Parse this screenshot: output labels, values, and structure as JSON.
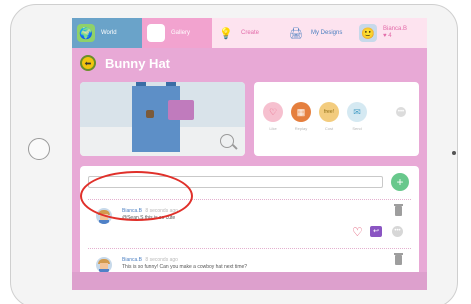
{
  "nav": {
    "tabs": [
      {
        "label": "World",
        "icon": "globe-icon"
      },
      {
        "label": "Gallery",
        "icon": "gallery-icon"
      },
      {
        "label": "Create",
        "icon": "lightbulb-icon"
      },
      {
        "label": "My Designs",
        "icon": "printer-icon"
      },
      {
        "label": "Bianca.B",
        "sub": "♥ 4",
        "icon": "avatar-icon"
      }
    ]
  },
  "page": {
    "title": "Bunny Hat"
  },
  "actions": {
    "like": "Like",
    "replay": "Replay",
    "cost": "Cost",
    "cost_value": "free!",
    "send": "Send"
  },
  "comments": {
    "input_placeholder": "",
    "items": [
      {
        "author": "Bianca.B",
        "time": "8 seconds ago",
        "text": "@Sean.S this is so cute"
      },
      {
        "author": "Bianca.B",
        "time": "8 seconds ago",
        "text": "This is so funny! Can you make a cowboy hat next time?"
      }
    ]
  },
  "colors": {
    "screen_bg": "#e8a9d6",
    "accent_pink": "#e26aa8",
    "author_blue": "#4b7fc2",
    "add_green": "#68c88c",
    "annotation_red": "#e0302a"
  }
}
